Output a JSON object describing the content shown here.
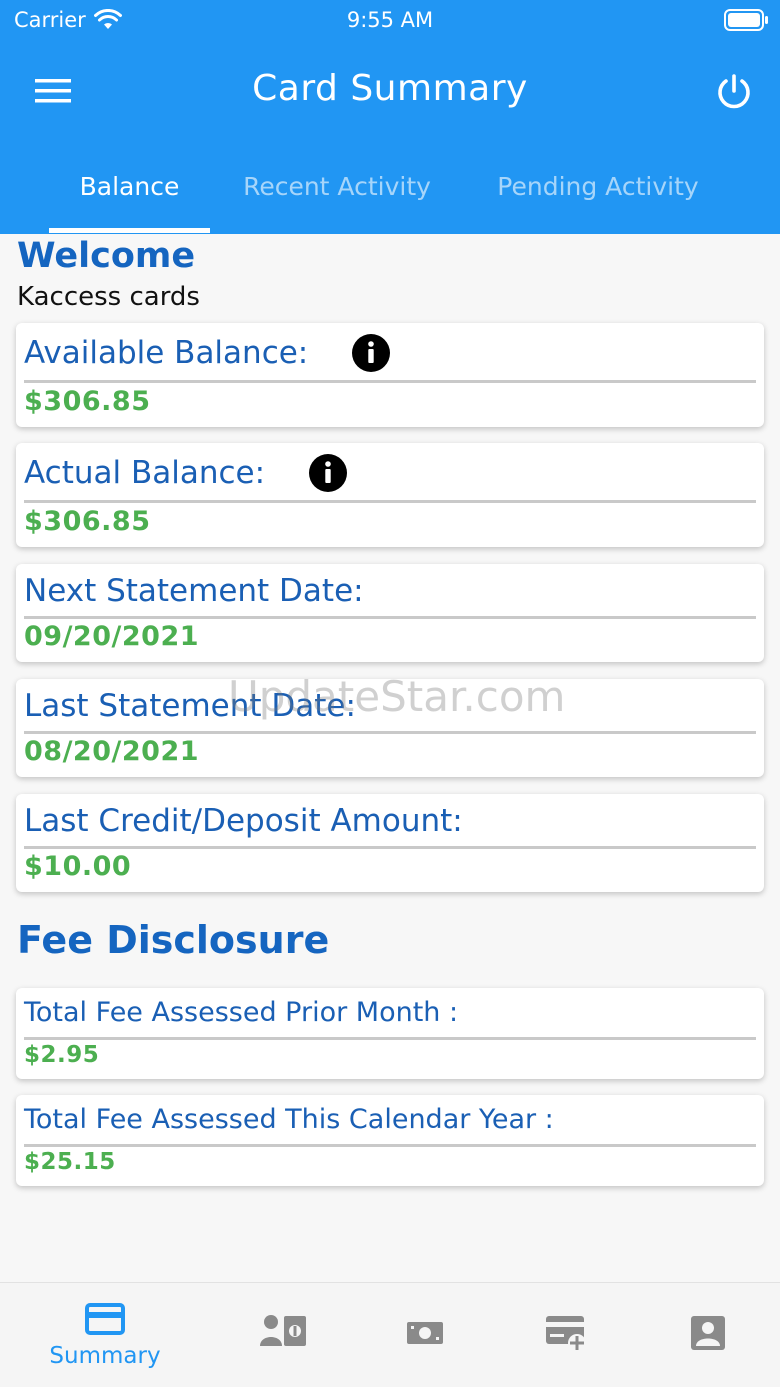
{
  "status_bar": {
    "carrier": "Carrier",
    "time": "9:55 AM"
  },
  "header": {
    "title": "Card Summary"
  },
  "tabs": [
    {
      "label": "Balance",
      "active": true
    },
    {
      "label": "Recent Activity",
      "active": false
    },
    {
      "label": "Pending Activity",
      "active": false
    }
  ],
  "welcome": {
    "heading": "Welcome",
    "subtitle": "Kaccess cards"
  },
  "balance_cards": [
    {
      "label": "Available Balance:",
      "value": "$306.85",
      "has_info": true
    },
    {
      "label": "Actual Balance:",
      "value": "$306.85",
      "has_info": true
    },
    {
      "label": "Next Statement Date:",
      "value": "09/20/2021",
      "has_info": false
    },
    {
      "label": "Last Statement Date:",
      "value": "08/20/2021",
      "has_info": false
    },
    {
      "label": "Last Credit/Deposit Amount:",
      "value": "$10.00",
      "has_info": false
    }
  ],
  "fee_disclosure": {
    "title": "Fee Disclosure",
    "items": [
      {
        "label": "Total Fee Assessed Prior Month :",
        "value": "$2.95"
      },
      {
        "label": "Total Fee Assessed This Calendar Year :",
        "value": "$25.15"
      }
    ]
  },
  "watermark": "UpdateStar.com",
  "bottom_nav": [
    {
      "icon": "card-icon",
      "label": "Summary",
      "active": true
    },
    {
      "icon": "person-money-icon",
      "label": "",
      "active": false
    },
    {
      "icon": "cash-icon",
      "label": "",
      "active": false
    },
    {
      "icon": "card-add-icon",
      "label": "",
      "active": false
    },
    {
      "icon": "account-icon",
      "label": "",
      "active": false
    }
  ],
  "colors": {
    "primary": "#2196f3",
    "heading_blue": "#1565c0",
    "label_blue": "#1a5fb4",
    "value_green": "#4caf50"
  }
}
